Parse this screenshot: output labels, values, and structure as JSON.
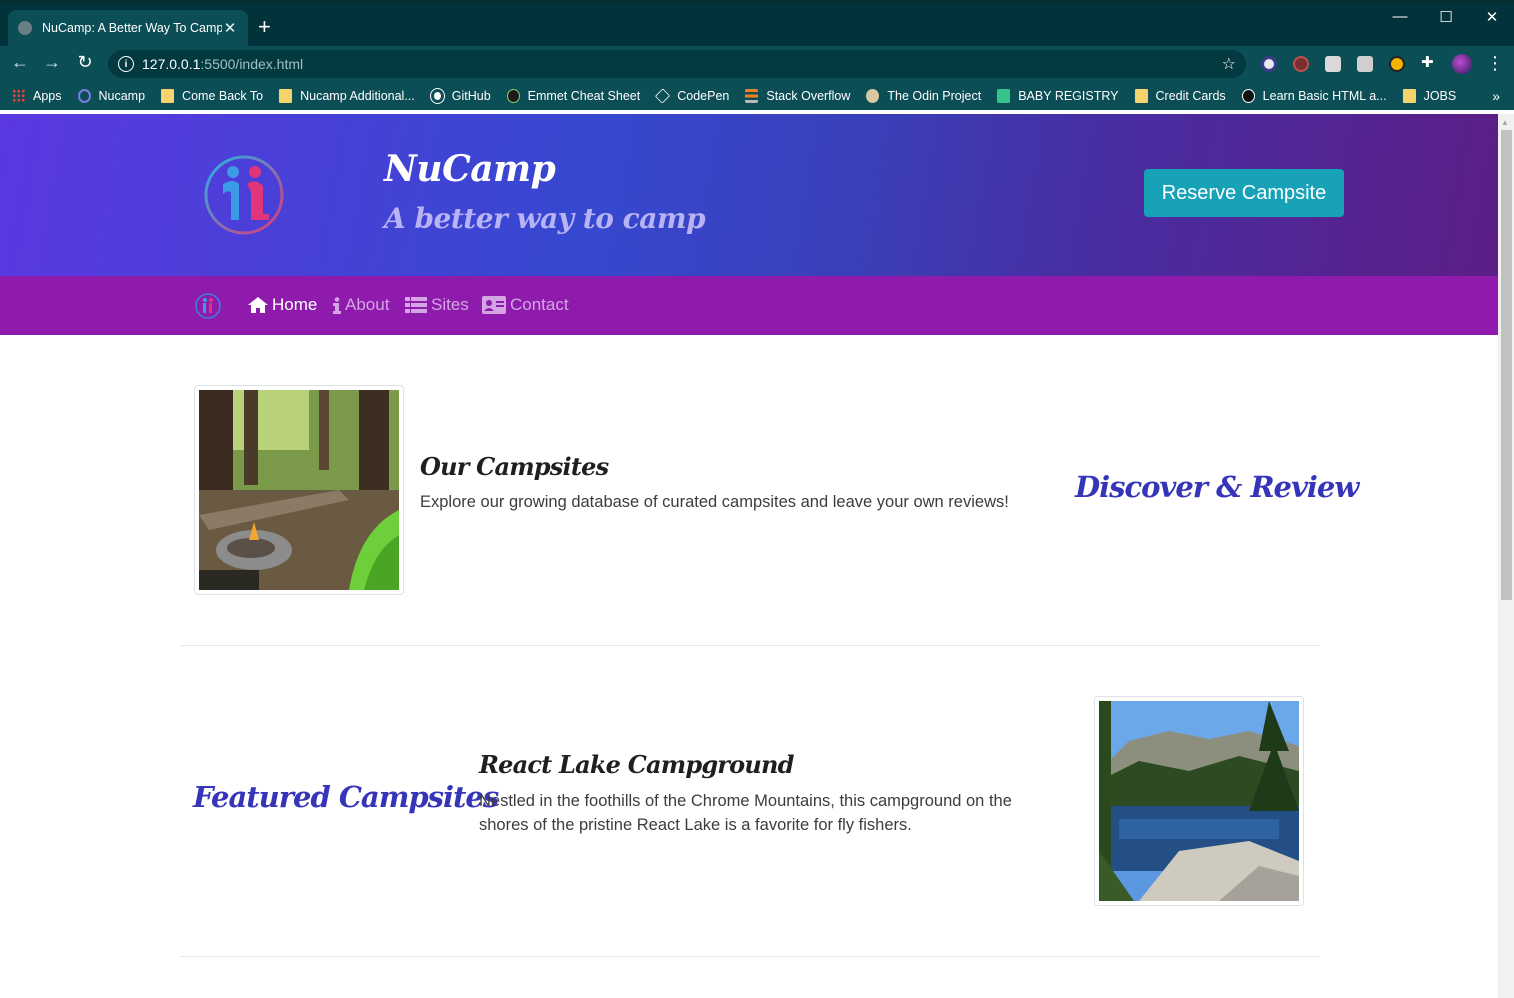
{
  "browser": {
    "tab_title": "NuCamp: A Better Way To Camp",
    "tab_close": "✕",
    "new_tab": "+",
    "url_host": "127.0.0.1",
    "url_path": ":5500/index.html",
    "bookmarks": [
      {
        "label": "Apps",
        "icon": "apps-grid-icon"
      },
      {
        "label": "Nucamp",
        "icon": "nucamp-icon"
      },
      {
        "label": "Come Back To",
        "icon": "folder-icon"
      },
      {
        "label": "Nucamp Additional...",
        "icon": "folder-icon"
      },
      {
        "label": "GitHub",
        "icon": "github-icon"
      },
      {
        "label": "Emmet Cheat Sheet",
        "icon": "emmet-icon"
      },
      {
        "label": "CodePen",
        "icon": "codepen-icon"
      },
      {
        "label": "Stack Overflow",
        "icon": "stackoverflow-icon"
      },
      {
        "label": "The Odin Project",
        "icon": "odin-icon"
      },
      {
        "label": "BABY REGISTRY",
        "icon": "gift-icon"
      },
      {
        "label": "Credit Cards",
        "icon": "folder-icon"
      },
      {
        "label": "Learn Basic HTML a...",
        "icon": "angular-icon"
      },
      {
        "label": "JOBS",
        "icon": "folder-icon"
      }
    ],
    "more": "»"
  },
  "header": {
    "brand": "NuCamp",
    "tagline": "A better way to camp",
    "reserve_button": "Reserve Campsite"
  },
  "nav": {
    "items": [
      {
        "label": "Home",
        "icon": "home-icon",
        "active": true
      },
      {
        "label": "About",
        "icon": "info-icon",
        "active": false
      },
      {
        "label": "Sites",
        "icon": "list-icon",
        "active": false
      },
      {
        "label": "Contact",
        "icon": "address-card-icon",
        "active": false
      }
    ]
  },
  "sections": [
    {
      "title": "Our Campsites",
      "text": "Explore our growing database of curated campsites and leave your own reviews!",
      "side_title": "Discover & Review"
    },
    {
      "title": "React Lake Campground",
      "text_line1": "Nestled in the foothills of the Chrome Mountains, this campground on the",
      "text_line2": "shores of the pristine React Lake is a favorite for fly fishers.",
      "side_title": "Featured Campsites"
    }
  ],
  "colors": {
    "browser_dark": "#02333a",
    "browser_toolbar": "#0b4e56",
    "header_gradient_start": "#5b38e0",
    "header_gradient_end": "#5d1e86",
    "navbar": "#8f1bad",
    "reserve_button": "#17a2b8",
    "side_title": "#3635b9"
  }
}
